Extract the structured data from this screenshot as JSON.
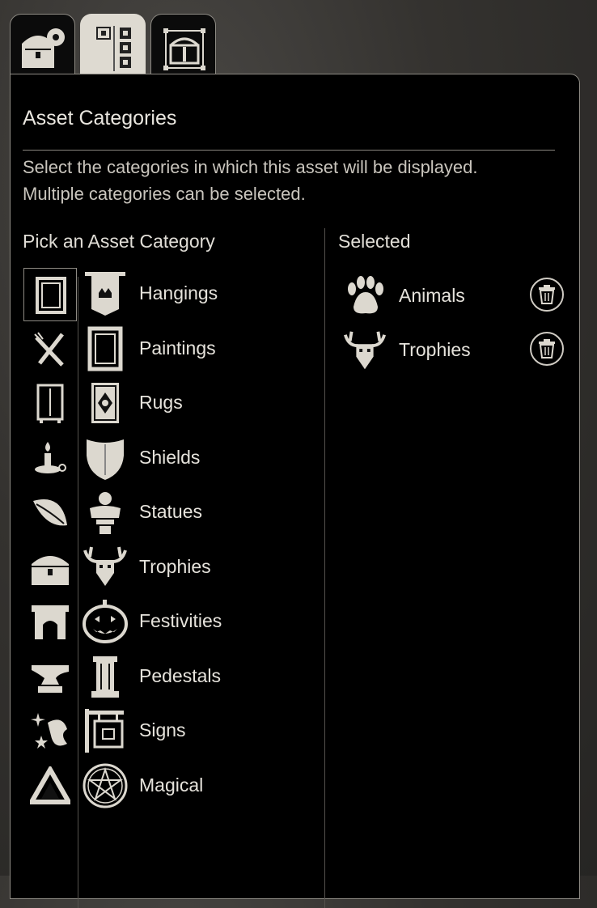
{
  "tabs": [
    {
      "name": "chest-settings-icon",
      "active": false
    },
    {
      "name": "category-layout-icon",
      "active": true
    },
    {
      "name": "chest-bounds-icon",
      "active": false
    }
  ],
  "panel": {
    "title": "Asset Categories",
    "description_line1": "Select the categories in which this asset will be displayed.",
    "description_line2": "Multiple categories can be selected.",
    "pick_heading": "Pick an Asset Category",
    "selected_heading": "Selected"
  },
  "side_groups": [
    {
      "icon": "framed-painting-icon",
      "selected": true
    },
    {
      "icon": "fork-knife-icon",
      "selected": false
    },
    {
      "icon": "wardrobe-icon",
      "selected": false
    },
    {
      "icon": "candle-icon",
      "selected": false
    },
    {
      "icon": "leaf-icon",
      "selected": false
    },
    {
      "icon": "treasure-chest-icon",
      "selected": false
    },
    {
      "icon": "fireplace-icon",
      "selected": false
    },
    {
      "icon": "anvil-icon",
      "selected": false
    },
    {
      "icon": "sparkle-icon",
      "selected": false
    },
    {
      "icon": "triangle-icon",
      "selected": false
    }
  ],
  "categories": [
    {
      "label": "Hangings",
      "icon": "banner-icon"
    },
    {
      "label": "Paintings",
      "icon": "painting-icon"
    },
    {
      "label": "Rugs",
      "icon": "rug-icon"
    },
    {
      "label": "Shields",
      "icon": "shield-icon"
    },
    {
      "label": "Statues",
      "icon": "bust-icon"
    },
    {
      "label": "Trophies",
      "icon": "antler-skull-icon"
    },
    {
      "label": "Festivities",
      "icon": "pumpkin-icon"
    },
    {
      "label": "Pedestals",
      "icon": "pillar-icon"
    },
    {
      "label": "Signs",
      "icon": "hanging-sign-icon"
    },
    {
      "label": "Magical",
      "icon": "pentagram-icon"
    }
  ],
  "selected": [
    {
      "label": "Animals",
      "icon": "paw-icon",
      "action_icon": "trash-icon"
    },
    {
      "label": "Trophies",
      "icon": "antler-skull-icon",
      "action_icon": "trash-icon"
    }
  ],
  "colors": {
    "icon": "#dcd8cf",
    "panel_bg": "#000000",
    "active_tab": "#dedad1"
  }
}
